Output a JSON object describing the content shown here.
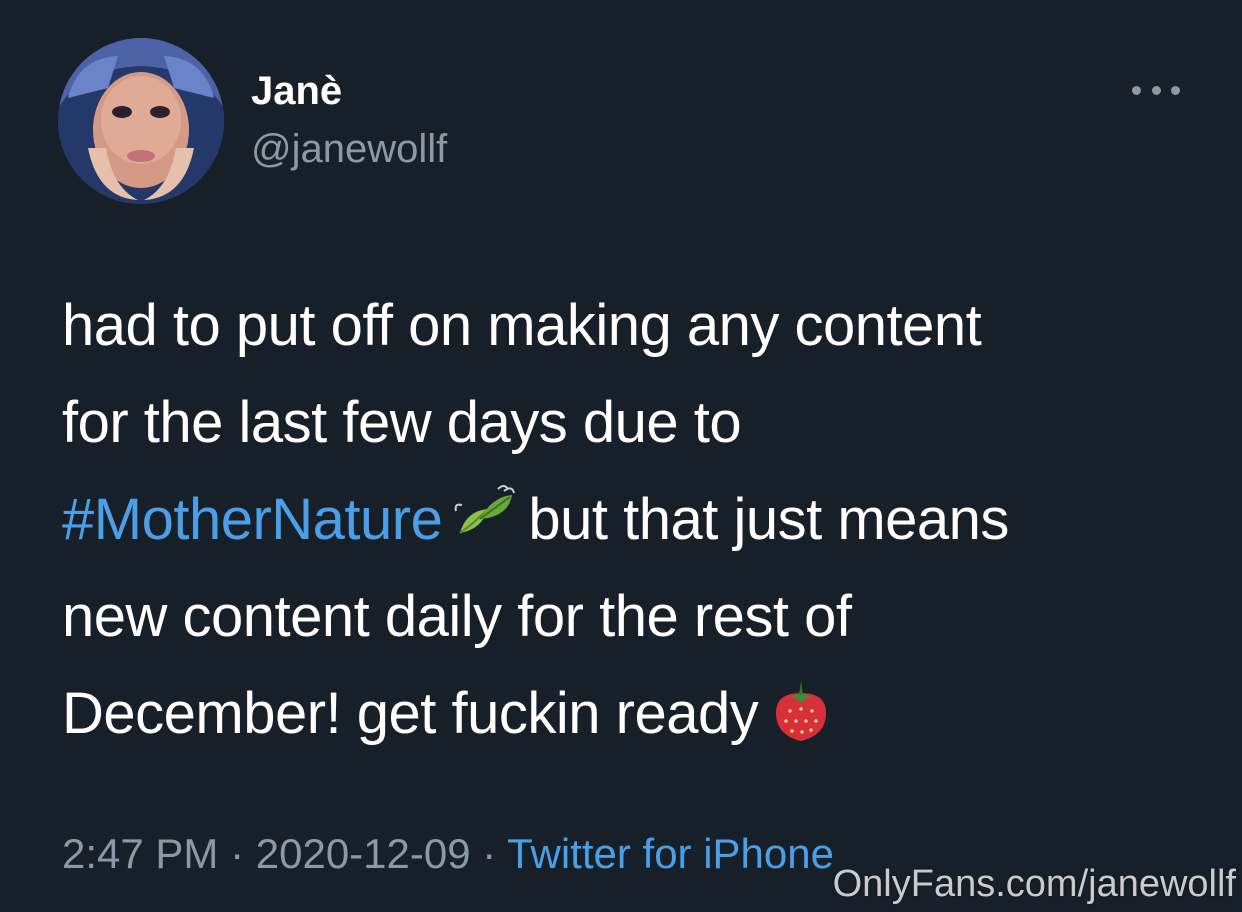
{
  "author": {
    "display_name": "Janè",
    "handle": "@janewollf"
  },
  "tweet": {
    "line1": "had to put off on making any content",
    "line2": "for the last few days due to",
    "hashtag": "#MotherNature",
    "line3_after": "but that just means",
    "line4": "new content daily for the rest of",
    "line5": "December! get fuckin ready",
    "emoji1": "leaf-fluttering-in-wind-emoji",
    "emoji2": "strawberry-emoji"
  },
  "meta": {
    "time": "2:47 PM",
    "separator": " · ",
    "date": "2020-12-09",
    "source": "Twitter for iPhone"
  },
  "watermark": "OnlyFans.com/janewollf",
  "colors": {
    "background": "#172029",
    "text": "#ffffff",
    "secondary": "#8b98a5",
    "link": "#4a9fe8"
  }
}
